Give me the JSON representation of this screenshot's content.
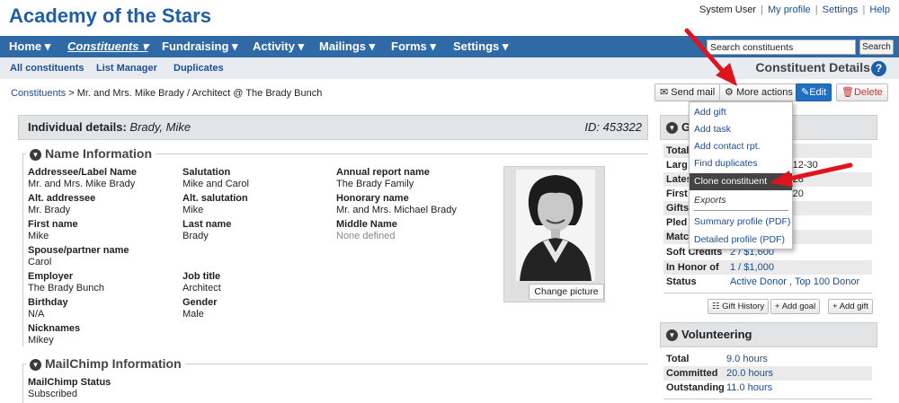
{
  "header": {
    "title": "Academy of the Stars",
    "user": "System User",
    "links": [
      "My profile",
      "Settings",
      "Help"
    ]
  },
  "nav": {
    "items": [
      "Home",
      "Constituents",
      "Fundraising",
      "Activity",
      "Mailings",
      "Forms",
      "Settings"
    ],
    "search_placeholder": "Search constituents",
    "search_button": "Search"
  },
  "subnav": {
    "items": [
      "All constituents",
      "List Manager",
      "Duplicates"
    ],
    "page_heading": "Constituent Details"
  },
  "breadcrumb": {
    "root": "Constituents",
    "trail": " > Mr. and Mrs. Mike Brady / Architect @ The Brady Bunch"
  },
  "actions": {
    "send_mail": "Send mail",
    "more_actions": "More actions",
    "edit": "Edit",
    "delete": "Delete"
  },
  "dropdown": {
    "items": [
      "Add gift",
      "Add task",
      "Add contact rpt.",
      "Find duplicates",
      "Clone constituent"
    ],
    "section_header": "Exports",
    "exports": [
      "Summary profile (PDF)",
      "Detailed profile (PDF)"
    ]
  },
  "individual": {
    "label": "Individual details:",
    "name": "Brady, Mike",
    "id": "ID: 453322"
  },
  "name_info": {
    "title": "Name Information",
    "fields": [
      {
        "label": "Addressee/Label Name",
        "value": "Mr. and Mrs. Mike Brady"
      },
      {
        "label": "Salutation",
        "value": "Mike and Carol"
      },
      {
        "label": "Annual report name",
        "value": "The Brady Family"
      },
      {
        "label": "Alt. addressee",
        "value": "Mr. Brady"
      },
      {
        "label": "Alt. salutation",
        "value": "Mike"
      },
      {
        "label": "Honorary name",
        "value": "Mr. and Mrs. Michael Brady"
      },
      {
        "label": "First name",
        "value": "Mike"
      },
      {
        "label": "Last name",
        "value": "Brady"
      },
      {
        "label": "Middle Name",
        "value": "None defined"
      },
      {
        "label": "Spouse/partner name",
        "value": "Carol"
      },
      {
        "label": "Employer",
        "value": "The Brady Bunch"
      },
      {
        "label": "Job title",
        "value": "Architect"
      },
      {
        "label": "Birthday",
        "value": "N/A"
      },
      {
        "label": "Gender",
        "value": "Male"
      },
      {
        "label": "Nicknames",
        "value": "Mikey"
      }
    ],
    "change_picture": "Change picture"
  },
  "mailchimp": {
    "title": "MailChimp Information",
    "status_label": "MailChimp Status",
    "status_value": "Subscribed"
  },
  "gifts": {
    "title_initial": "G",
    "rows": [
      {
        "label": "Total",
        "value": ""
      },
      {
        "label": "Larg",
        "value": "-12-30"
      },
      {
        "label": "Lates",
        "value": "-28"
      },
      {
        "label": "First",
        "value": "-20"
      },
      {
        "label": "Gifts",
        "value": ""
      },
      {
        "label": "Pled",
        "value": ""
      },
      {
        "label": "Matc",
        "value": ""
      },
      {
        "label": "Soft Credits",
        "value": "2 / $1,600"
      },
      {
        "label": "In Honor of",
        "value": "1 / $1,000"
      },
      {
        "label": "Status",
        "value": "Active Donor , Top 100 Donor"
      }
    ],
    "buttons": [
      "Gift History",
      "Add goal",
      "Add gift"
    ]
  },
  "volunteering": {
    "title": "Volunteering",
    "rows": [
      {
        "label": "Total",
        "value": "9.0 hours"
      },
      {
        "label": "Committed",
        "value": "20.0 hours"
      },
      {
        "label": "Outstanding",
        "value": "11.0 hours"
      }
    ]
  },
  "colors": {
    "brand_blue": "#1f5ea8",
    "nav_bar": "#2f6aa6",
    "arrow_red": "#e0141e",
    "highlight": "#444444"
  }
}
